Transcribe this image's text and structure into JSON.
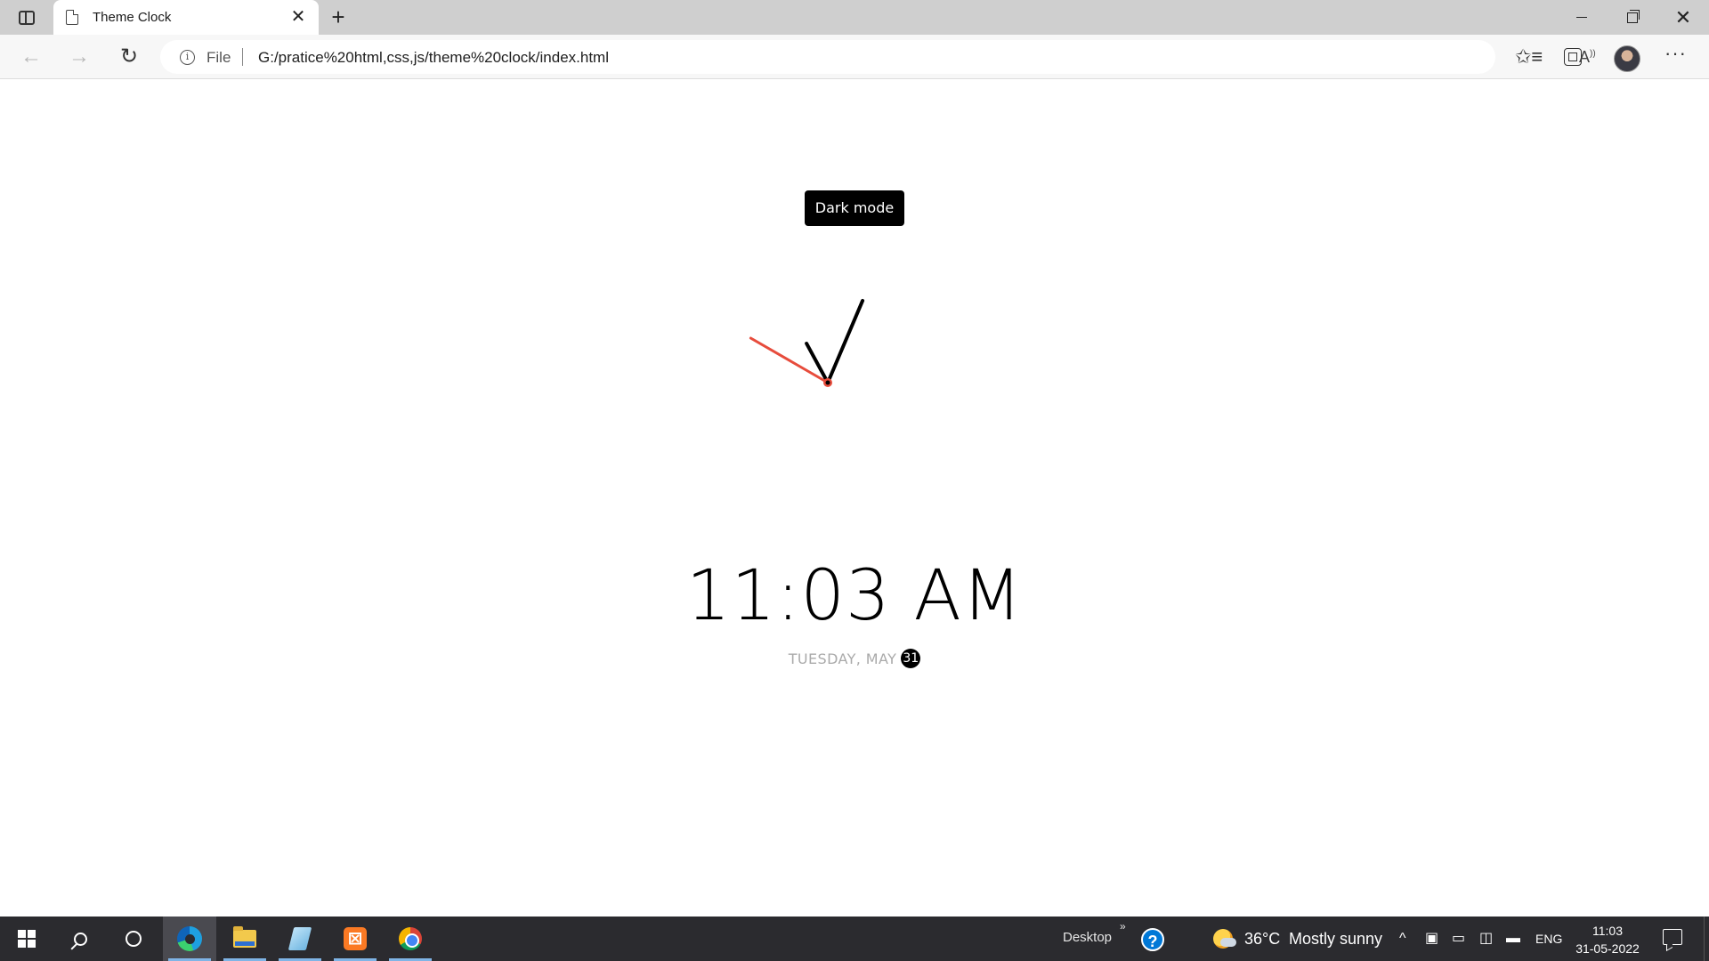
{
  "browser": {
    "tab_title": "Theme Clock",
    "tab_close_glyph": "✕",
    "new_tab_glyph": "+",
    "address": {
      "scheme_label": "File",
      "url": "G:/pratice%20html,css,js/theme%20clock/index.html"
    },
    "icons": [
      "tab-actions-icon",
      "page-icon",
      "back-arrow-icon",
      "forward-arrow-icon",
      "refresh-icon",
      "info-icon",
      "read-aloud-icon",
      "add-favorite-icon",
      "favorites-icon",
      "collections-icon",
      "profile-avatar",
      "more-options-icon",
      "minimize-icon",
      "restore-icon",
      "close-icon"
    ]
  },
  "page": {
    "toggle_button_label": "Dark mode",
    "time": "11:03 AM",
    "date_text": "TUESDAY, MAY",
    "date_day": "31",
    "clock": {
      "hours": 11,
      "minutes": 3,
      "seconds": 50,
      "hand_color": "#000000",
      "second_hand_color": "#e74c3c"
    }
  },
  "taskbar": {
    "pinned": [
      "start-icon",
      "search-icon",
      "cortana-icon",
      "edge-icon",
      "file-explorer-icon",
      "paper-app-icon",
      "xampp-icon",
      "chrome-icon"
    ],
    "desktop_label": "Desktop",
    "chevron_glyph": "»",
    "help_glyph": "?",
    "weather": {
      "temperature": "36°C",
      "condition": "Mostly sunny"
    },
    "tray_caret": "^",
    "language": "ENG",
    "clock_time": "11:03",
    "clock_date": "31-05-2022"
  },
  "colors": {
    "accent_second_hand": "#e74c3c",
    "taskbar": "#2b2b2f",
    "button_bg": "#000000"
  }
}
